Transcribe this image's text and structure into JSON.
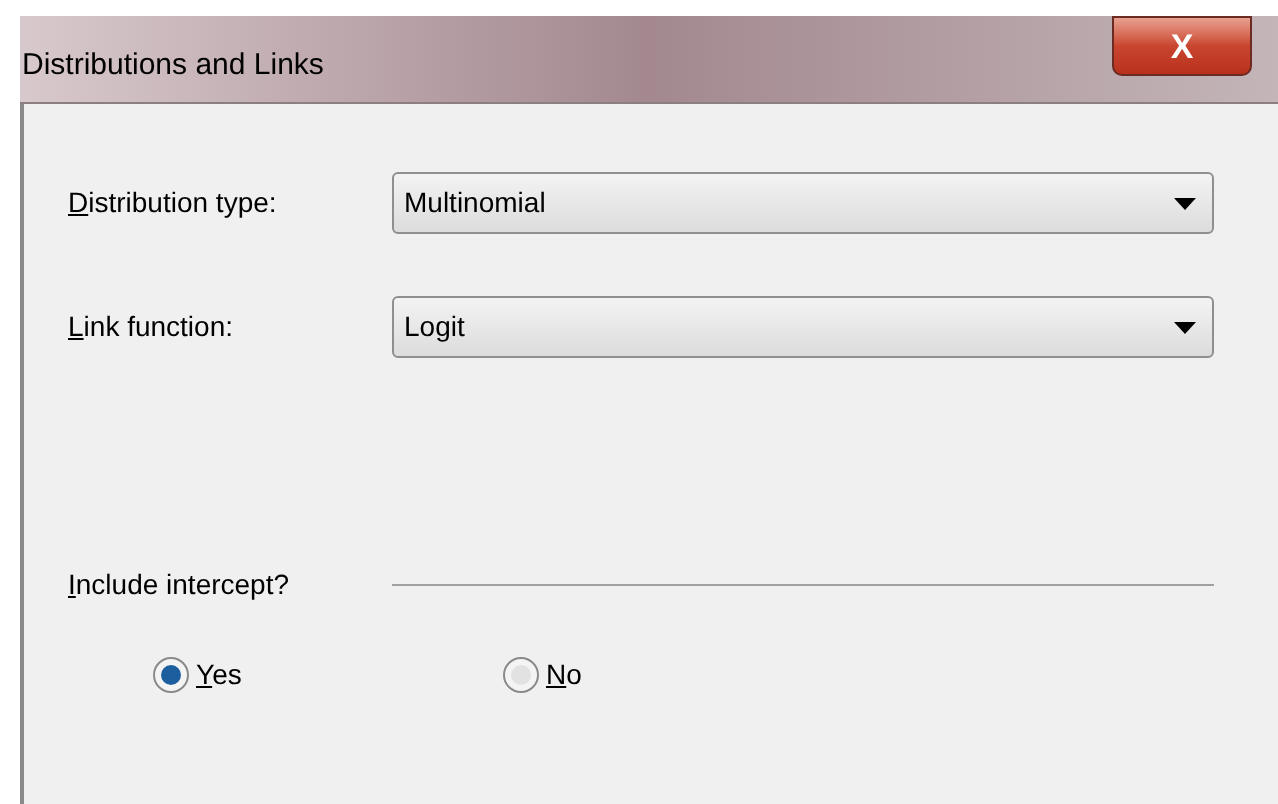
{
  "window": {
    "title": "Distributions and Links",
    "close": "X"
  },
  "fields": [
    {
      "label": "Distribution type:",
      "underline_first": true,
      "value": "Multinomial"
    },
    {
      "label": "Link function:",
      "underline_first": true,
      "value": "Logit"
    }
  ],
  "intercept": {
    "label": "Include intercept?",
    "underline_first": true,
    "options": [
      {
        "label": "Yes",
        "underline_first": true,
        "selected": true
      },
      {
        "label": "No",
        "underline_first": true,
        "selected": false
      }
    ]
  }
}
